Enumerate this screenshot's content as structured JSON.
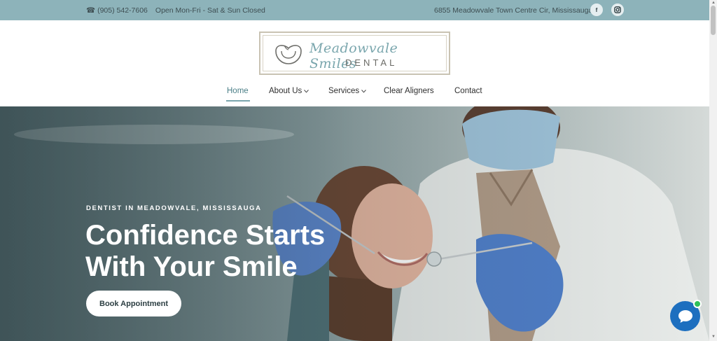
{
  "topbar": {
    "phone": "(905) 542-7606",
    "hours": "Open Mon-Fri - Sat & Sun Closed",
    "address": "6855 Meadowvale Town Centre Cir, Mississauga",
    "facebook_icon": "f",
    "instagram_icon": "instagram-icon"
  },
  "logo": {
    "script_text": "Meadowvale Smiles",
    "sub_text": "DENTAL"
  },
  "nav": {
    "items": [
      {
        "label": "Home",
        "active": true
      },
      {
        "label": "About Us",
        "dropdown": true
      },
      {
        "label": "Services",
        "dropdown": true
      },
      {
        "label": "Clear Aligners"
      },
      {
        "label": "Contact"
      }
    ]
  },
  "hero": {
    "kicker": "DENTIST IN MEADOWVALE, MISSISSAUGA",
    "title": "Confidence Starts With Your Smile",
    "button": "Book Appointment"
  },
  "colors": {
    "topbar_bg": "#8db3ba",
    "accent": "#7aa6ad",
    "chat_bg": "#1d6fbf",
    "online_dot": "#2ec05a"
  }
}
